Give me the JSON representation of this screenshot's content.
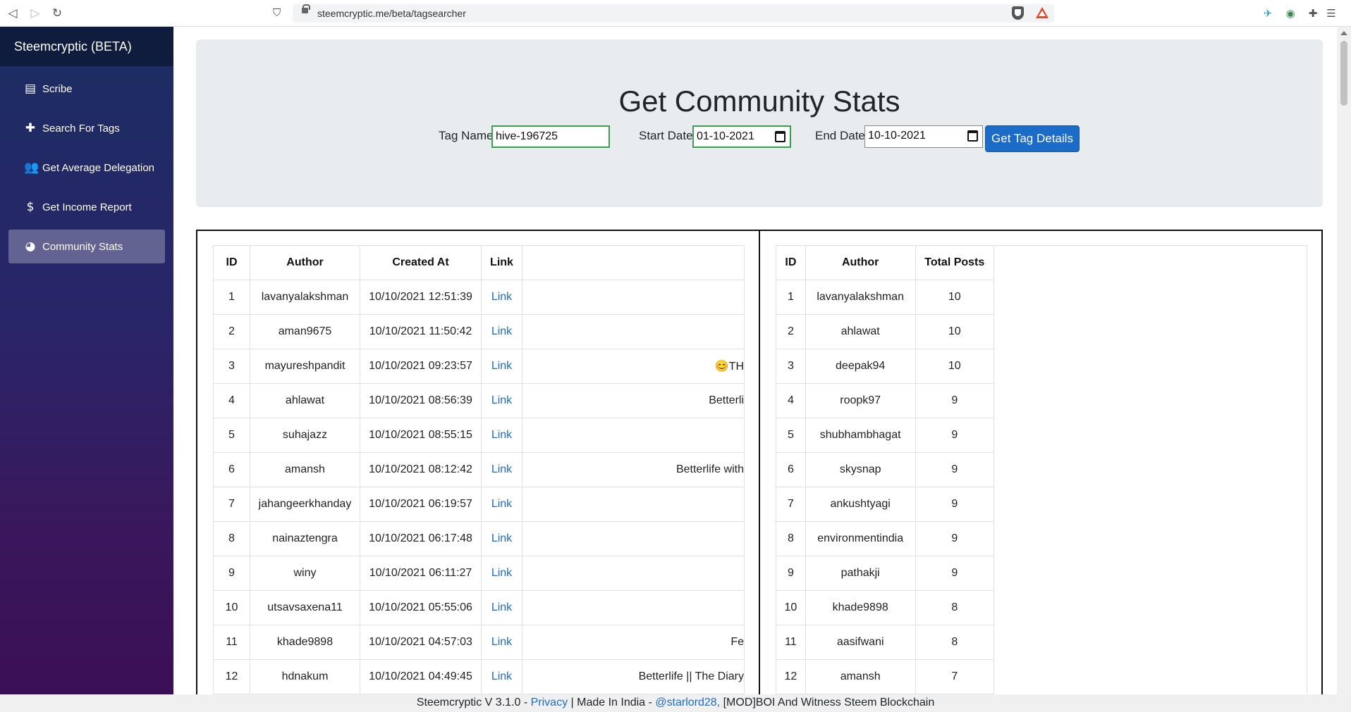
{
  "browser": {
    "url": "steemcryptic.me/beta/tagsearcher"
  },
  "sidebar": {
    "brand": "Steemcryptic (BETA)",
    "items": [
      {
        "label": "Scribe",
        "icon": "scribe-icon"
      },
      {
        "label": "Search For Tags",
        "icon": "plus-icon"
      },
      {
        "label": "Get Average Delegation",
        "icon": "users-icon"
      },
      {
        "label": "Get Income Report",
        "icon": "dollar-icon"
      },
      {
        "label": "Community Stats",
        "icon": "pie-chart-icon",
        "active": true
      }
    ]
  },
  "form": {
    "title": "Get Community Stats",
    "tag_label": "Tag Name",
    "tag_value": "hive-196725",
    "start_label": "Start Date",
    "start_value": "01-10-2021",
    "end_label": "End Date",
    "end_value": "10-10-2021",
    "submit_label": "Get Tag Details"
  },
  "posts_table": {
    "headers": [
      "ID",
      "Author",
      "Created At",
      "Link"
    ],
    "rows": [
      {
        "id": "1",
        "author": "lavanyalakshman",
        "created": "10/10/2021 12:51:39",
        "link": "Link",
        "title": ""
      },
      {
        "id": "2",
        "author": "aman9675",
        "created": "10/10/2021 11:50:42",
        "link": "Link",
        "title": ""
      },
      {
        "id": "3",
        "author": "mayureshpandit",
        "created": "10/10/2021 09:23:57",
        "link": "Link",
        "title": "😊TH"
      },
      {
        "id": "4",
        "author": "ahlawat",
        "created": "10/10/2021 08:56:39",
        "link": "Link",
        "title": "Betterli"
      },
      {
        "id": "5",
        "author": "suhajazz",
        "created": "10/10/2021 08:55:15",
        "link": "Link",
        "title": ""
      },
      {
        "id": "6",
        "author": "amansh",
        "created": "10/10/2021 08:12:42",
        "link": "Link",
        "title": "Betterlife with"
      },
      {
        "id": "7",
        "author": "jahangeerkhanday",
        "created": "10/10/2021 06:19:57",
        "link": "Link",
        "title": ""
      },
      {
        "id": "8",
        "author": "nainaztengra",
        "created": "10/10/2021 06:17:48",
        "link": "Link",
        "title": ""
      },
      {
        "id": "9",
        "author": "winy",
        "created": "10/10/2021 06:11:27",
        "link": "Link",
        "title": ""
      },
      {
        "id": "10",
        "author": "utsavsaxena11",
        "created": "10/10/2021 05:55:06",
        "link": "Link",
        "title": ""
      },
      {
        "id": "11",
        "author": "khade9898",
        "created": "10/10/2021 04:57:03",
        "link": "Link",
        "title": "Fe"
      },
      {
        "id": "12",
        "author": "hdnakum",
        "created": "10/10/2021 04:49:45",
        "link": "Link",
        "title": "Betterlife || The Diary"
      }
    ]
  },
  "totals_table": {
    "headers": [
      "ID",
      "Author",
      "Total Posts"
    ],
    "rows": [
      {
        "id": "1",
        "author": "lavanyalakshman",
        "total": "10"
      },
      {
        "id": "2",
        "author": "ahlawat",
        "total": "10"
      },
      {
        "id": "3",
        "author": "deepak94",
        "total": "10"
      },
      {
        "id": "4",
        "author": "roopk97",
        "total": "9"
      },
      {
        "id": "5",
        "author": "shubhambhagat",
        "total": "9"
      },
      {
        "id": "6",
        "author": "skysnap",
        "total": "9"
      },
      {
        "id": "7",
        "author": "ankushtyagi",
        "total": "9"
      },
      {
        "id": "8",
        "author": "environmentindia",
        "total": "9"
      },
      {
        "id": "9",
        "author": "pathakji",
        "total": "9"
      },
      {
        "id": "10",
        "author": "khade9898",
        "total": "8"
      },
      {
        "id": "11",
        "author": "aasifwani",
        "total": "8"
      },
      {
        "id": "12",
        "author": "amansh",
        "total": "7"
      }
    ]
  },
  "footer": {
    "prefix": "Steemcryptic V 3.1.0 - ",
    "privacy": "Privacy",
    "middle": " | Made In India - ",
    "handle": "@starlord28,",
    "suffix": " [MOD]BOI And Witness Steem Blockchain"
  },
  "colors": {
    "primary": "#1a6cc8",
    "sidebar_top": "#1b2d63",
    "sidebar_bottom": "#3b0f55",
    "input_focus_border": "#3c9e50"
  }
}
